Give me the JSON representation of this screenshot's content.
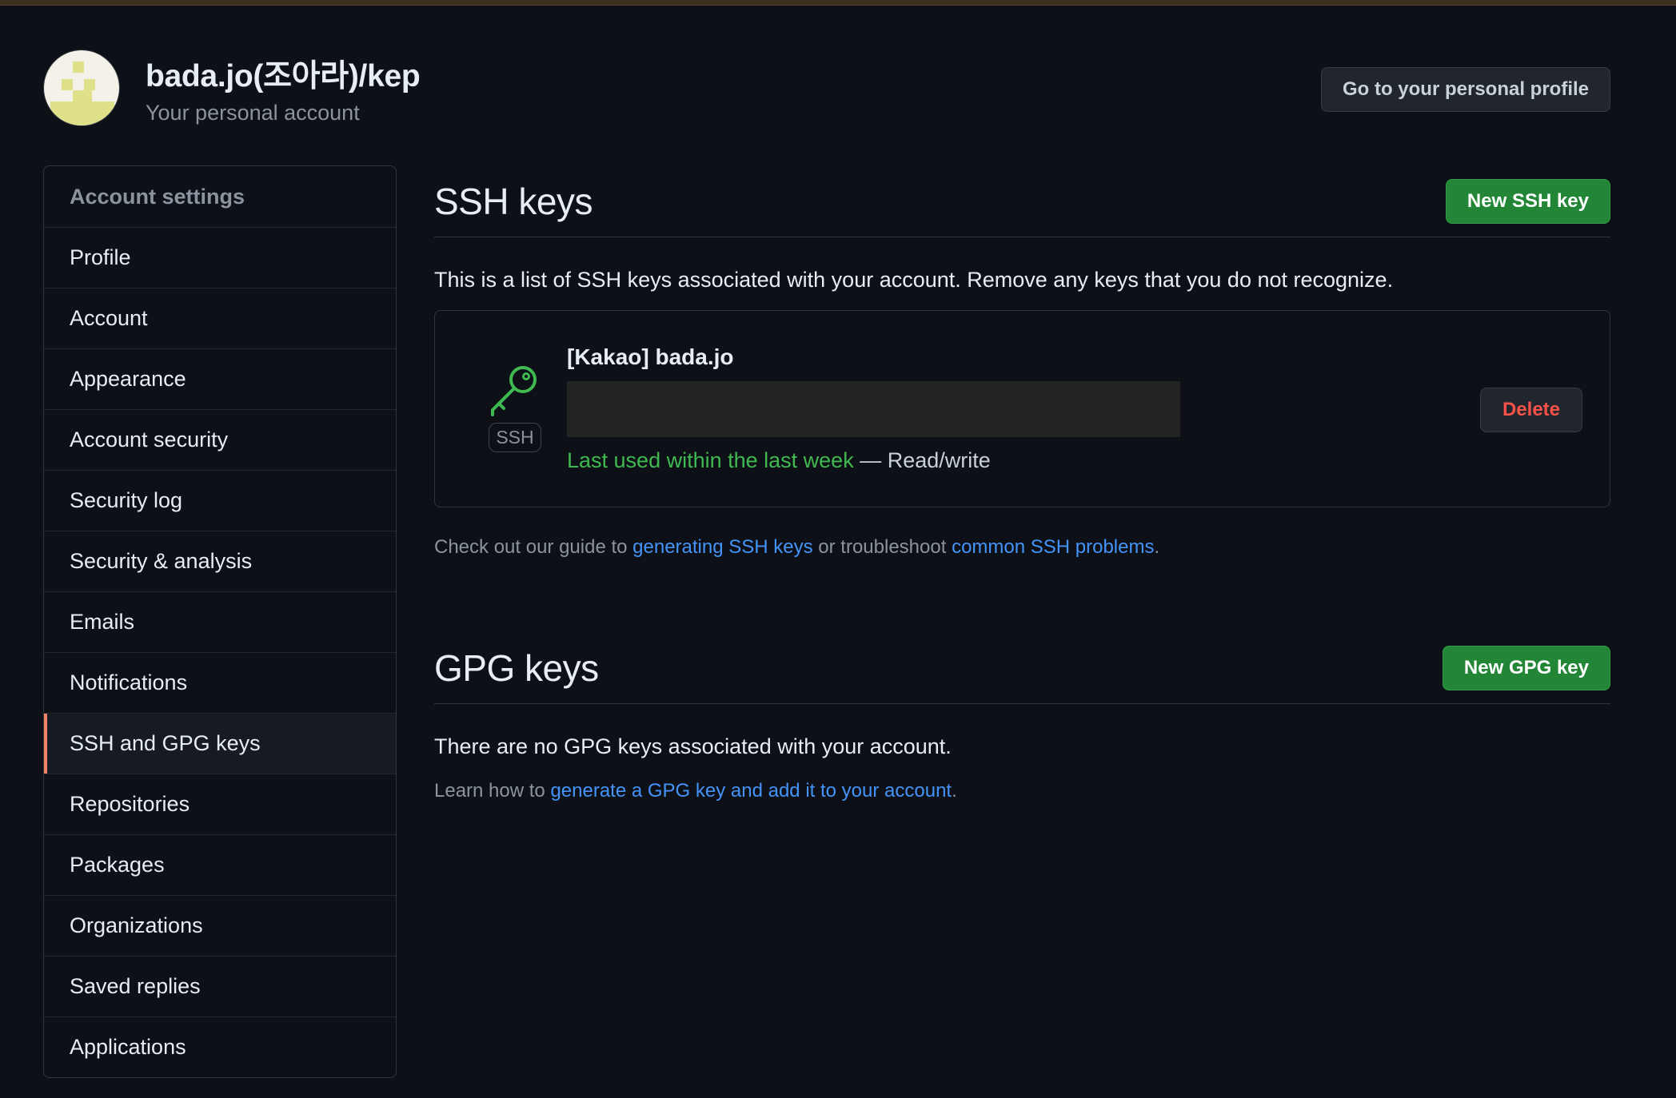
{
  "header": {
    "account_name": "bada.jo(조아라)/kep",
    "account_subtitle": "Your personal account",
    "profile_button": "Go to your personal profile"
  },
  "sidebar": {
    "items": [
      {
        "label": "Account settings",
        "type": "header"
      },
      {
        "label": "Profile"
      },
      {
        "label": "Account"
      },
      {
        "label": "Appearance"
      },
      {
        "label": "Account security"
      },
      {
        "label": "Security log"
      },
      {
        "label": "Security & analysis"
      },
      {
        "label": "Emails"
      },
      {
        "label": "Notifications"
      },
      {
        "label": "SSH and GPG keys",
        "active": true
      },
      {
        "label": "Repositories"
      },
      {
        "label": "Packages"
      },
      {
        "label": "Organizations"
      },
      {
        "label": "Saved replies"
      },
      {
        "label": "Applications"
      }
    ]
  },
  "ssh": {
    "title": "SSH keys",
    "new_button": "New SSH key",
    "description": "This is a list of SSH keys associated with your account. Remove any keys that you do not recognize.",
    "key": {
      "icon": "key-icon",
      "badge": "SSH",
      "name": "[Kakao] bada.jo",
      "usage": "Last used within the last week",
      "access": " — Read/write",
      "delete_button": "Delete"
    },
    "guide_prefix": "Check out our guide to ",
    "guide_link1": "generating SSH keys",
    "guide_middle": " or troubleshoot ",
    "guide_link2": "common SSH problems",
    "guide_suffix": "."
  },
  "gpg": {
    "title": "GPG keys",
    "new_button": "New GPG key",
    "description": "There are no GPG keys associated with your account.",
    "learn_prefix": "Learn how to ",
    "learn_link": "generate a GPG key and add it to your account",
    "learn_suffix": "."
  },
  "colors": {
    "background": "#0d1117",
    "green_button": "#238636",
    "link": "#4493f8",
    "danger": "#f85149",
    "active_indicator": "#f78166"
  }
}
